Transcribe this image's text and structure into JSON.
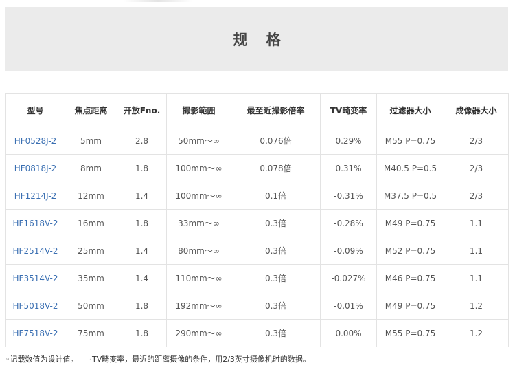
{
  "page": {
    "title": "规 格"
  },
  "table": {
    "headers": [
      "型号",
      "焦点距离",
      "开放Fno.",
      "撮影範囲",
      "最至近撮影倍率",
      "TV畸变率",
      "过滤器大小",
      "成像器大小"
    ],
    "rows": [
      [
        "HF0528J-2",
        "5mm",
        "2.8",
        "50mm～∞",
        "0.076倍",
        "0.29%",
        "M55 P=0.75",
        "2/3"
      ],
      [
        "HF0818J-2",
        "8mm",
        "1.8",
        "100mm～∞",
        "0.078倍",
        "0.31%",
        "M40.5 P=0.5",
        "2/3"
      ],
      [
        "HF1214J-2",
        "12mm",
        "1.4",
        "100mm～∞",
        "0.1倍",
        "-0.31%",
        "M37.5 P=0.5",
        "2/3"
      ],
      [
        "HF1618V-2",
        "16mm",
        "1.8",
        "33mm～∞",
        "0.3倍",
        "-0.28%",
        "M49 P=0.75",
        "1.1"
      ],
      [
        "HF2514V-2",
        "25mm",
        "1.4",
        "80mm～∞",
        "0.3倍",
        "-0.09%",
        "M52 P=0.75",
        "1.1"
      ],
      [
        "HF3514V-2",
        "35mm",
        "1.4",
        "110mm～∞",
        "0.3倍",
        "-0.027%",
        "M46 P=0.75",
        "1.1"
      ],
      [
        "HF5018V-2",
        "50mm",
        "1.8",
        "192mm～∞",
        "0.3倍",
        "-0.01%",
        "M49 P=0.75",
        "1.2"
      ],
      [
        "HF7518V-2",
        "75mm",
        "1.8",
        "290mm～∞",
        "0.3倍",
        "0.00%",
        "M55 P=0.75",
        "1.2"
      ]
    ]
  },
  "notes": {
    "note1": "◦记载数值为设计值。",
    "note2": "◦TV畸变率，最近的距离摄像的条件，用2/3英寸摄像机时的数据。"
  },
  "colors": {
    "title_band": "#ebebeb",
    "model_link": "#3a6fb2",
    "border": "#e3e3e3"
  }
}
